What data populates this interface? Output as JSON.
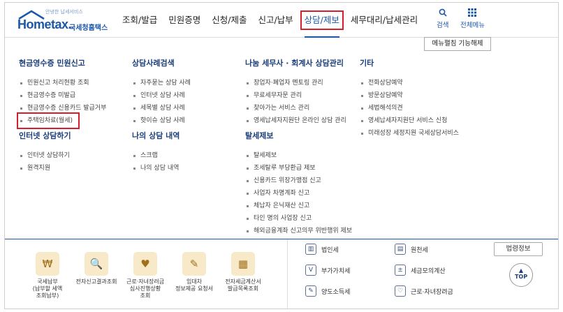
{
  "header": {
    "logo_tiny": "안녕한 납세서비스",
    "logo_mark": "Hometax.",
    "logo_sub": "국세청홈택스",
    "nav": [
      "조회/발급",
      "민원증명",
      "신청/제출",
      "신고/납부",
      "상담/제보",
      "세무대리/납세관리"
    ],
    "active_nav": "상담/제보",
    "search_label": "검색",
    "allmenu_label": "전체메뉴"
  },
  "menu_fix_label": "메뉴펼침 기능해제",
  "menu": {
    "col1": {
      "groups": [
        {
          "title": "현금영수증 민원신고",
          "items": [
            "민원신고 처리현황 조회",
            "현금영수증 미발급",
            "현금영수증 신용카드 발급거부",
            "주택임차료(월세)"
          ]
        },
        {
          "title": "인터넷 상담하기",
          "items": [
            "인터넷 상담하기",
            "원격지원"
          ]
        }
      ]
    },
    "col2": {
      "groups": [
        {
          "title": "상담사례검색",
          "items": [
            "자주묻는 상담 사례",
            "인터넷 상담 사례",
            "세목별 상담 사례",
            "핫이슈 상담 사례"
          ]
        },
        {
          "title": "나의 상담 내역",
          "items": [
            "스크랩",
            "나의 상담 내역"
          ]
        }
      ]
    },
    "col3": {
      "groups": [
        {
          "title": "나눔 세무사 · 회계사 상담관리",
          "items": [
            "창업자·폐업자 멘토링 관리",
            "무료세무자문 관리",
            "찾아가는 서비스 관리",
            "영세납세자지원단 온라인 상담 관리"
          ]
        },
        {
          "title": "탈세제보",
          "items": [
            "탈세제보",
            "조세탈루 부당환급 제보",
            "신용카드 위장가맹점 신고",
            "사업자 차명계좌 신고",
            "체납자 은닉재산 신고",
            "타인 명의 사업장 신고",
            "해외금융계좌 신고의무 위반행위 제보"
          ]
        }
      ]
    },
    "col4": {
      "groups": [
        {
          "title": "기타",
          "items": [
            "전화상담예약",
            "방문상담예약",
            "세법해석의견",
            "영세납세자지원단 서비스 신청",
            "미래성장 세정지원 국세상담서비스"
          ]
        }
      ]
    }
  },
  "footer": {
    "shortcuts": [
      {
        "label": "국세납부\n(납부할 세액\n조회납부)",
        "icon": "money-bag-icon",
        "glyph": "₩"
      },
      {
        "label": "전자신고결과조회",
        "icon": "document-search-icon",
        "glyph": "🔍"
      },
      {
        "label": "근로·자녀장려금\n심사진행상황\n조회",
        "icon": "heart-hands-icon",
        "glyph": "♥"
      },
      {
        "label": "임대차\n정보제공 요청서",
        "icon": "contract-icon",
        "glyph": "✎"
      },
      {
        "label": "전자세금계산서\n발급목록조회",
        "icon": "invoice-icon",
        "glyph": "▦"
      }
    ],
    "links": [
      {
        "label": "법인세",
        "icon": "corporate-tax-icon",
        "glyph": "▥"
      },
      {
        "label": "원천세",
        "icon": "withholding-tax-icon",
        "glyph": "▤"
      },
      {
        "label": "부가가치세",
        "icon": "vat-icon",
        "glyph": "V"
      },
      {
        "label": "세금모의계산",
        "icon": "calculator-icon",
        "glyph": "±"
      },
      {
        "label": "양도소득세",
        "icon": "transfer-tax-icon",
        "glyph": "✎"
      },
      {
        "label": "근로·자녀장려금",
        "icon": "heart-icon",
        "glyph": "♡"
      }
    ],
    "law_label": "법령정보",
    "top_label": "TOP"
  }
}
